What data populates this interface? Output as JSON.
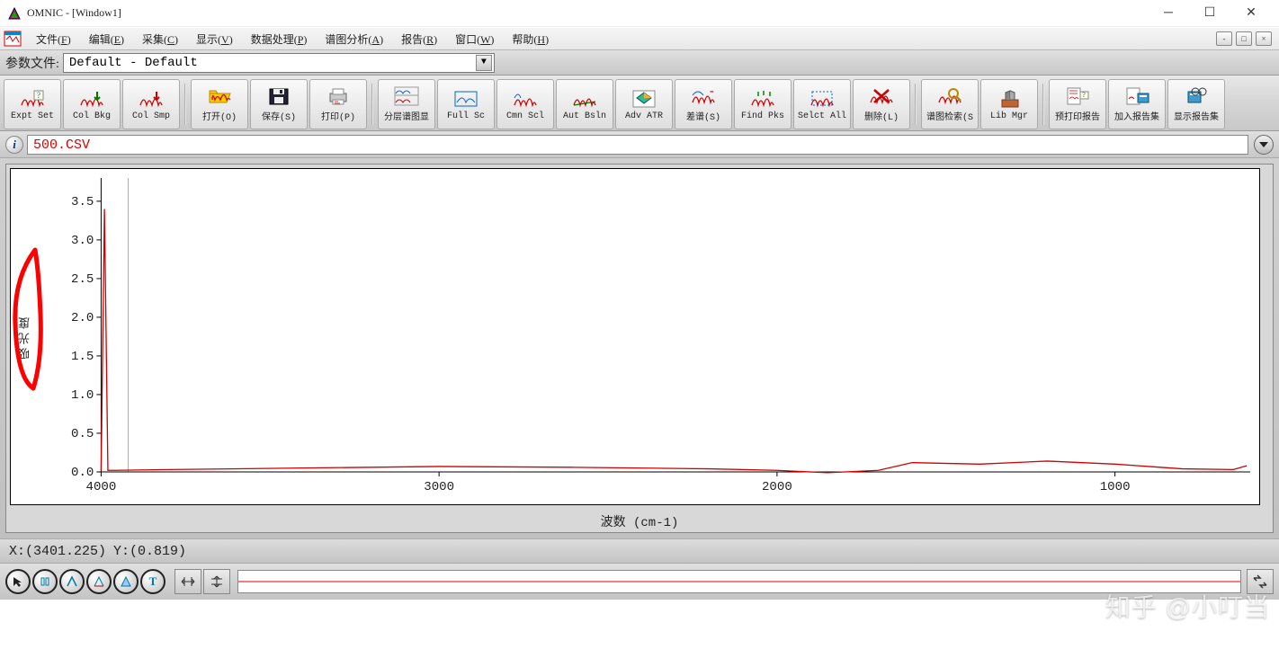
{
  "title": "OMNIC - [Window1]",
  "menu": {
    "items": [
      {
        "label": "文件",
        "hotkey": "F"
      },
      {
        "label": "编辑",
        "hotkey": "E"
      },
      {
        "label": "采集",
        "hotkey": "C"
      },
      {
        "label": "显示",
        "hotkey": "V"
      },
      {
        "label": "数据处理",
        "hotkey": "P"
      },
      {
        "label": "谱图分析",
        "hotkey": "A"
      },
      {
        "label": "报告",
        "hotkey": "R"
      },
      {
        "label": "窗口",
        "hotkey": "W"
      },
      {
        "label": "帮助",
        "hotkey": "H"
      }
    ]
  },
  "param": {
    "label": "参数文件:",
    "value": "Default - Default"
  },
  "toolbar": {
    "groups": [
      [
        {
          "id": "expt-set",
          "label": "Expt Set"
        },
        {
          "id": "col-bkg",
          "label": "Col Bkg"
        },
        {
          "id": "col-smp",
          "label": "Col Smp"
        }
      ],
      [
        {
          "id": "open",
          "label": "打开(O)"
        },
        {
          "id": "save",
          "label": "保存(S)"
        },
        {
          "id": "print",
          "label": "打印(P)"
        }
      ],
      [
        {
          "id": "stack",
          "label": "分层谱图显"
        },
        {
          "id": "full-sc",
          "label": "Full Sc"
        },
        {
          "id": "cmn-scl",
          "label": "Cmn Scl"
        },
        {
          "id": "aut-bsln",
          "label": "Aut Bsln"
        },
        {
          "id": "adv-atr",
          "label": "Adv ATR"
        },
        {
          "id": "subtract",
          "label": "差谱(S)"
        },
        {
          "id": "find-pks",
          "label": "Find Pks"
        },
        {
          "id": "selct-all",
          "label": "Selct All"
        },
        {
          "id": "delete",
          "label": "删除(L)"
        }
      ],
      [
        {
          "id": "spec-search",
          "label": "谱图检索(S"
        },
        {
          "id": "lib-mgr",
          "label": "Lib Mgr"
        }
      ],
      [
        {
          "id": "preview",
          "label": "预打印报告"
        },
        {
          "id": "add-report",
          "label": "加入报告集"
        },
        {
          "id": "show-report",
          "label": "显示报告集"
        }
      ]
    ]
  },
  "spectrum": {
    "info_icon": "ⓘ",
    "title": "500.CSV"
  },
  "chart_data": {
    "type": "line",
    "title": "",
    "xlabel": "波数 (cm-1)",
    "ylabel": "吸光度",
    "xlim": [
      4000,
      600
    ],
    "ylim": [
      0.0,
      3.8
    ],
    "y_ticks": [
      0.0,
      0.5,
      1.0,
      1.5,
      2.0,
      2.5,
      3.0,
      3.5
    ],
    "x_ticks": [
      4000,
      3000,
      2000,
      1000
    ],
    "series": [
      {
        "name": "500.CSV",
        "color": "#d00000",
        "x": [
          4000,
          3990,
          3980,
          3960,
          3800,
          3400,
          3000,
          2600,
          2200,
          2000,
          1850,
          1700,
          1600,
          1400,
          1200,
          1000,
          800,
          650,
          610
        ],
        "y": [
          0.02,
          3.4,
          0.02,
          0.02,
          0.03,
          0.05,
          0.07,
          0.06,
          0.04,
          0.02,
          -0.01,
          0.02,
          0.12,
          0.1,
          0.14,
          0.1,
          0.04,
          0.03,
          0.08
        ]
      }
    ]
  },
  "status": {
    "x_label": "X:",
    "x_value": "(3401.225)",
    "y_label": "Y:",
    "y_value": "(0.819)"
  },
  "watermark": "知乎 @小叮当"
}
